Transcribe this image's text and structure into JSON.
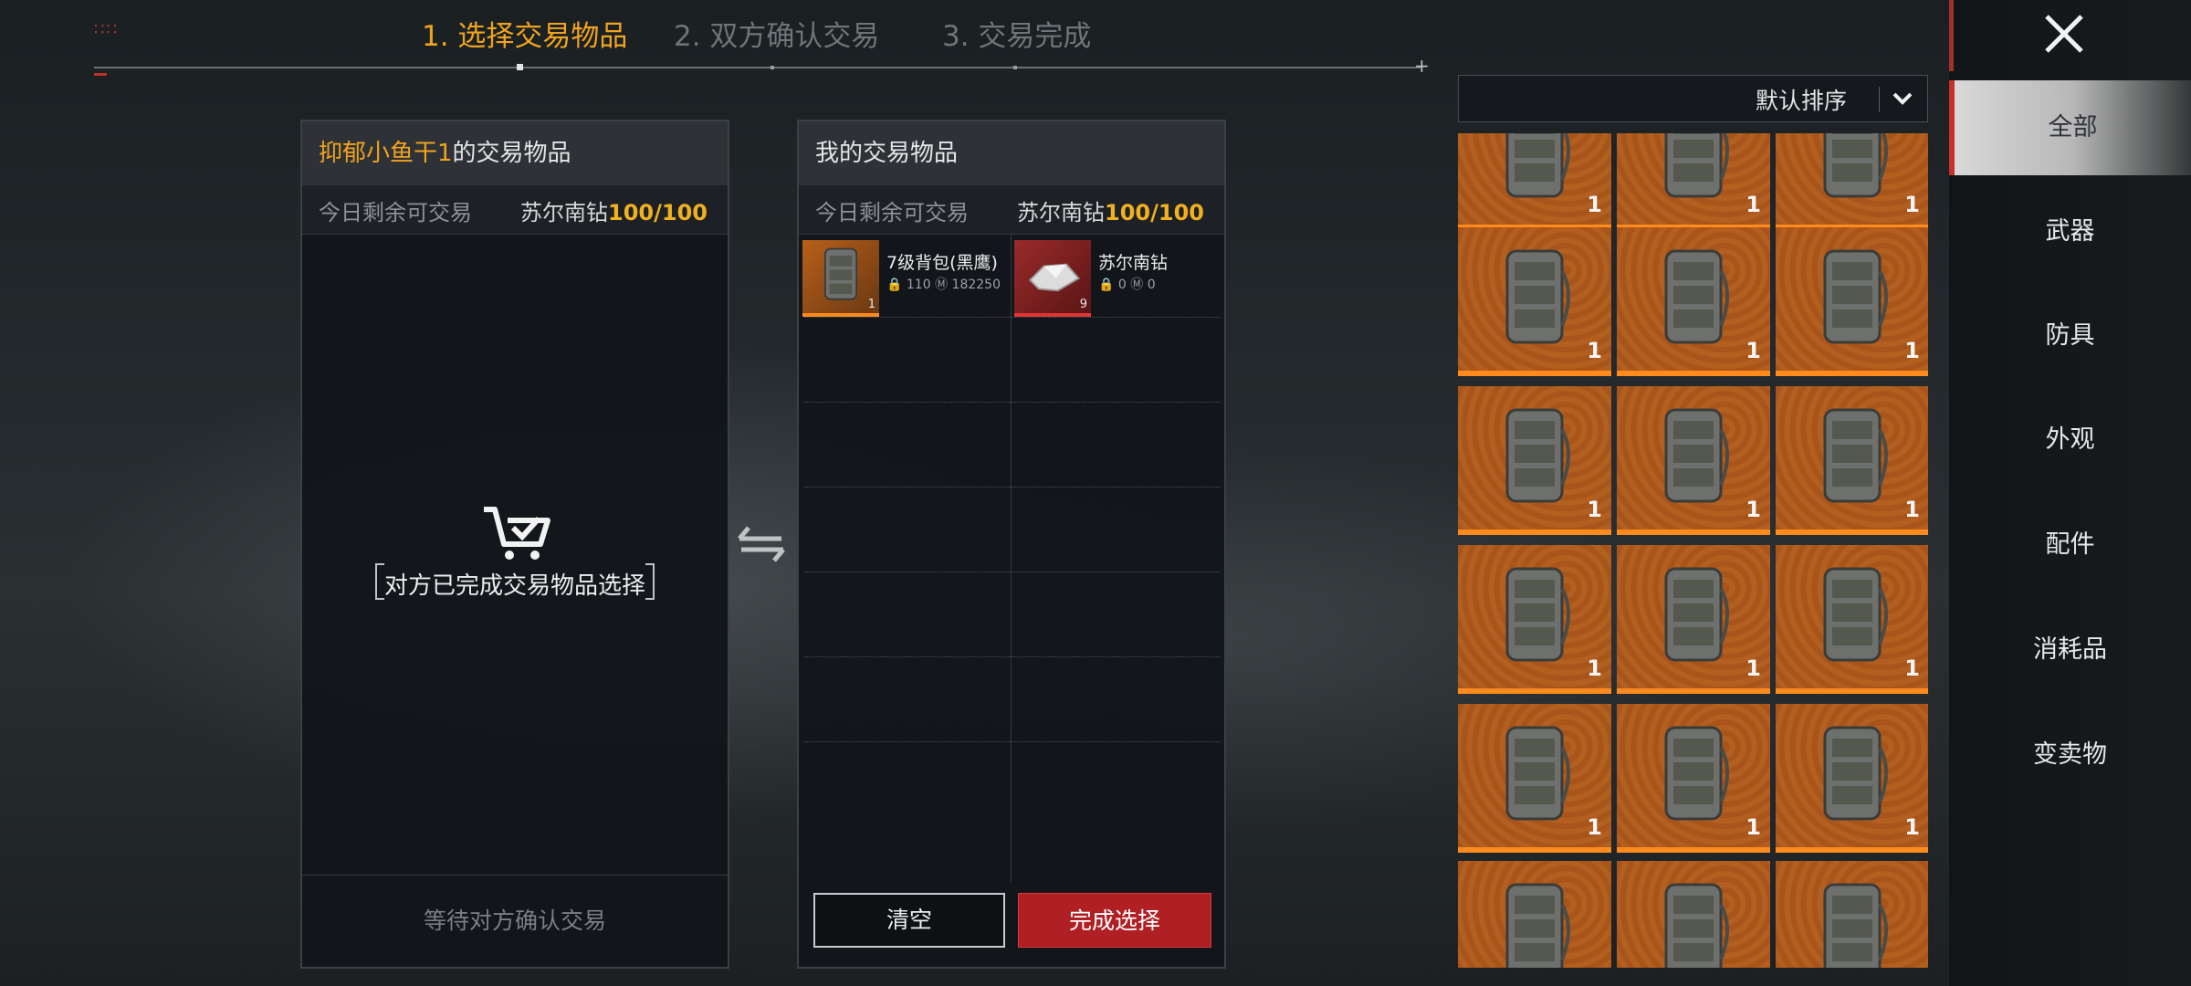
{
  "steps": [
    {
      "label": "1. 选择交易物品"
    },
    {
      "label": "2. 双方确认交易"
    },
    {
      "label": "3. 交易完成"
    }
  ],
  "left_panel": {
    "owner_name": "抑郁小鱼干1",
    "title_suffix": "的交易物品",
    "quota_label": "今日剩余可交易",
    "quota_currency": "苏尔南钻",
    "quota_value": "100/100",
    "status_message": "对方已完成交易物品选择",
    "footer": "等待对方确认交易"
  },
  "right_panel": {
    "title": "我的交易物品",
    "quota_label": "今日剩余可交易",
    "quota_currency": "苏尔南钻",
    "quota_value": "100/100",
    "items": [
      {
        "name": "7级背包(黑鹰)",
        "lock": "110",
        "price": "182250",
        "count": "1",
        "rarity_color": "#ff8a1e"
      },
      {
        "name": "苏尔南钻",
        "lock": "0",
        "price": "0",
        "count": "9",
        "rarity_color": "#e03535"
      }
    ],
    "clear_button": "清空",
    "done_button": "完成选择"
  },
  "inventory": {
    "sort_label": "默认排序",
    "tile_count": "1",
    "rarity_color": "#ff8a1e"
  },
  "categories": [
    {
      "label": "全部",
      "active": true
    },
    {
      "label": "武器"
    },
    {
      "label": "防具"
    },
    {
      "label": "外观"
    },
    {
      "label": "配件"
    },
    {
      "label": "消耗品"
    },
    {
      "label": "变卖物"
    }
  ],
  "colors": {
    "accent_orange": "#f0a31e",
    "accent_red": "#b01f23"
  }
}
